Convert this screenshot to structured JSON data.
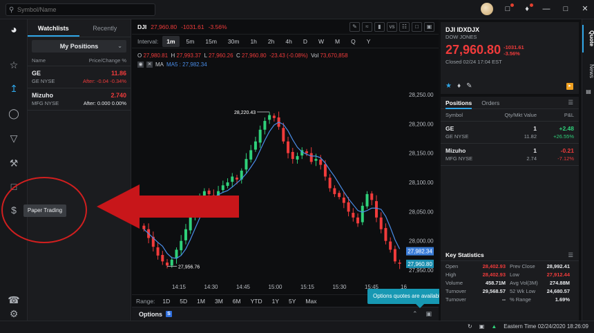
{
  "search": {
    "placeholder": "Symbol/Name"
  },
  "sidebar": {
    "tooltip": "Paper Trading"
  },
  "watchlist": {
    "tabs": [
      "Watchlists",
      "Recently"
    ],
    "selected_list": "My Positions",
    "columns": [
      "Name",
      "Price/Change %"
    ],
    "rows": [
      {
        "symbol": "GE",
        "exchange": "GE NYSE",
        "price": "11.86",
        "session": "After:",
        "change": "-0.04",
        "change_pct": "-0.34%"
      },
      {
        "symbol": "Mizuho",
        "exchange": "MFG NYSE",
        "price": "2.740",
        "session": "After:",
        "change": "0.000",
        "change_pct": "0.00%"
      }
    ]
  },
  "chart": {
    "symbol": "DJI",
    "last": "27,960.80",
    "change": "-1031.61",
    "change_pct": "-3.56%",
    "interval_label": "Interval:",
    "intervals": [
      "1m",
      "5m",
      "15m",
      "30m",
      "1h",
      "2h",
      "4h",
      "D",
      "W",
      "M",
      "Q",
      "Y"
    ],
    "active_interval": "1m",
    "ohlc": {
      "o_label": "O",
      "o": "27,980.81",
      "h_label": "H",
      "h": "27,993.37",
      "l_label": "L",
      "l": "27,960.26",
      "c_label": "C",
      "c": "27,960.80",
      "chg": "-23.43 (-0.08%)",
      "vol_label": "Vol",
      "vol": "73,670,858"
    },
    "ma_label": "MA",
    "ma_value": "MA5 : 27,982.34",
    "range_label": "Range:",
    "ranges": [
      "1D",
      "5D",
      "1M",
      "3M",
      "6M",
      "YTD",
      "1Y",
      "5Y",
      "Max"
    ],
    "options_label": "Options",
    "options_badge": "S",
    "toast": "Options quotes are available now.",
    "colors": {
      "up": "#2fd17a",
      "down": "#f03b3b",
      "ma": "#4a8de8"
    }
  },
  "chart_data": {
    "type": "candlestick",
    "x_ticks": [
      "14:15",
      "14:30",
      "14:45",
      "15:00",
      "15:15",
      "15:30",
      "15:45",
      "16"
    ],
    "y_ticks": [
      28250,
      28200,
      28150,
      28100,
      28050,
      28000,
      27950
    ],
    "ylim": [
      27930,
      28270
    ],
    "annotations": [
      {
        "label": "28,220.43",
        "x": "14:58",
        "y": 28220.43
      },
      {
        "label": "27,956.76",
        "x": "14:22",
        "y": 27956.76
      }
    ],
    "price_tags": [
      {
        "label": "27,982.34",
        "y": 27982.34,
        "color": "#3b7dd8"
      },
      {
        "label": "27,960.80",
        "y": 27960.8,
        "color": "#1a8fb0"
      }
    ],
    "series": [
      {
        "name": "price",
        "values": [
          28020,
          28005,
          27990,
          27975,
          27965,
          27958,
          27968,
          27985,
          28000,
          28020,
          28040,
          28060,
          28075,
          28085,
          28080,
          28070,
          28085,
          28095,
          28100,
          28110,
          28105,
          28120,
          28140,
          28155,
          28170,
          28190,
          28205,
          28215,
          28210,
          28195,
          28170,
          28150,
          28140,
          28145,
          28155,
          28150,
          28135,
          28140,
          28130,
          28110,
          28090,
          28080,
          28075,
          28065,
          28050,
          28040,
          28030,
          28060,
          28080,
          28070,
          28040,
          28020,
          28000,
          27985,
          27965,
          27961
        ]
      }
    ]
  },
  "quote": {
    "symbol_line": "DJI  IDXDJX",
    "name": "DOW JONES",
    "price": "27,960.80",
    "change": "-1031.61",
    "change_pct": "-3.56%",
    "closed": "Closed 02/24 17:04 EST"
  },
  "positions": {
    "tabs": [
      "Positions",
      "Orders"
    ],
    "columns": [
      "Symbol",
      "Qty/Mkt Value",
      "P&L"
    ],
    "rows": [
      {
        "symbol": "GE",
        "exchange": "GE NYSE",
        "qty": "1",
        "mkt": "11.82",
        "pl": "+2.48",
        "pl_pct": "+26.55%",
        "dir": "up"
      },
      {
        "symbol": "Mizuho",
        "exchange": "MFG NYSE",
        "qty": "1",
        "mkt": "2.74",
        "pl": "-0.21",
        "pl_pct": "-7.12%",
        "dir": "down"
      }
    ]
  },
  "key_stats": {
    "title": "Key Statistics",
    "rows": [
      [
        "Open",
        "28,402.93",
        "Prev Close",
        "28,992.41"
      ],
      [
        "High",
        "28,402.93",
        "Low",
        "27,912.44"
      ],
      [
        "Volume",
        "458.71M",
        "Avg Vol(3M)",
        "274.88M"
      ],
      [
        "Turnover",
        "29,568.57",
        "52 Wk Low",
        "24,680.57"
      ],
      [
        "Turnover",
        "--",
        "% Range",
        "1.69%"
      ]
    ]
  },
  "side_tabs": [
    "Quote",
    "News"
  ],
  "status": {
    "clock": "Eastern Time 02/24/2020 18:26:09"
  }
}
